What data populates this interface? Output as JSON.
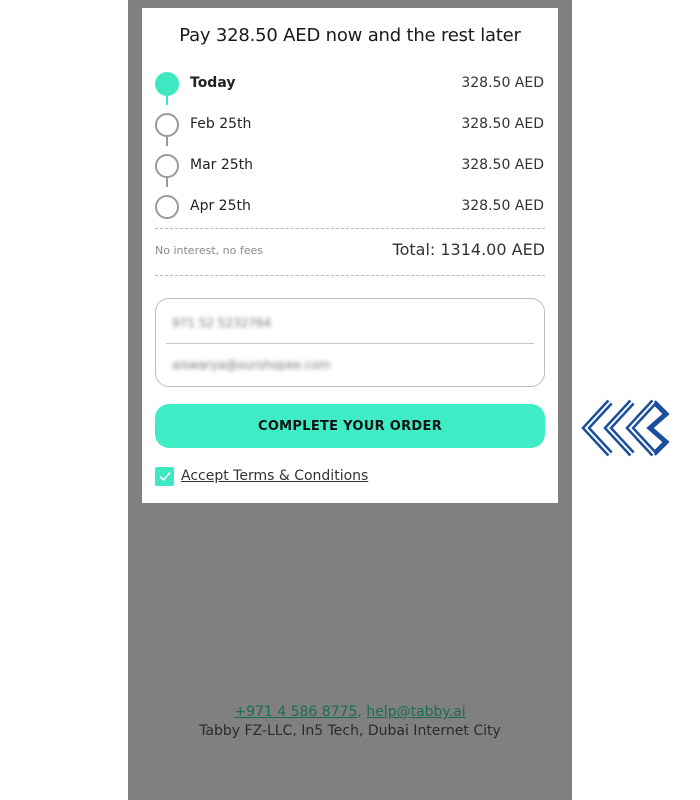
{
  "header": {
    "title": "Pay 328.50 AED now and the rest later"
  },
  "schedule": [
    {
      "label": "Today",
      "amount": "328.50 AED"
    },
    {
      "label": "Feb 25th",
      "amount": "328.50 AED"
    },
    {
      "label": "Mar 25th",
      "amount": "328.50 AED"
    },
    {
      "label": "Apr 25th",
      "amount": "328.50 AED"
    }
  ],
  "summary": {
    "note": "No interest, no fees",
    "total": "Total: 1314.00 AED"
  },
  "contact": {
    "phone": "971 52 5232764",
    "email": "aiswarya@ourshopee.com"
  },
  "cta": {
    "label": "COMPLETE YOUR ORDER"
  },
  "terms": {
    "label": "Accept Terms & Conditions",
    "checked": true
  },
  "footer": {
    "phone": "+971 4 586 8775",
    "email": "help@tabby.ai",
    "address": "Tabby FZ-LLC, In5 Tech, Dubai Internet City"
  },
  "colors": {
    "accent": "#3ee8c2",
    "overlay": "#808080",
    "brand": "#1d4e9e"
  },
  "icons": {
    "badge": "chevrons-left-icon",
    "check": "check-icon"
  }
}
